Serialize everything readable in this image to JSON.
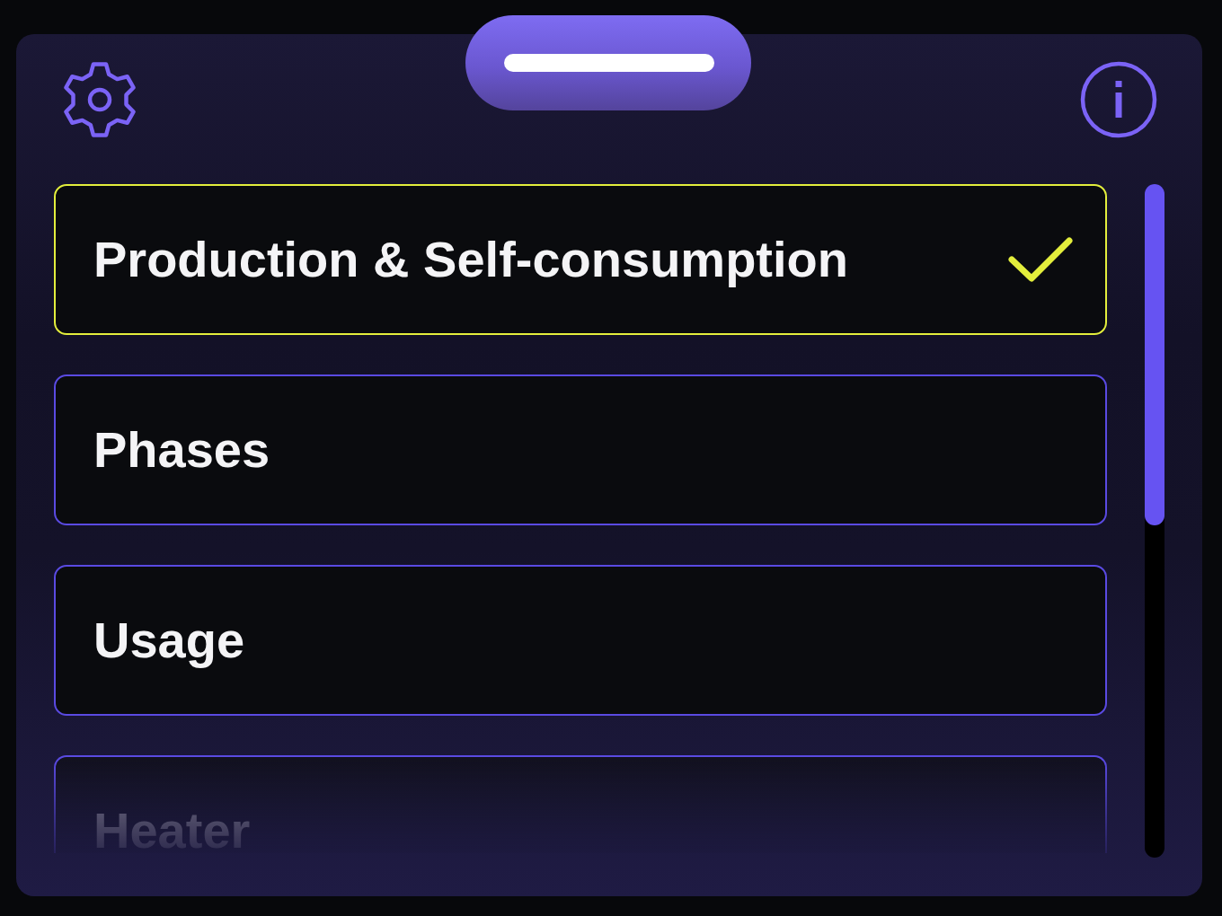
{
  "options": [
    {
      "label": "Production & Self-consumption",
      "selected": true
    },
    {
      "label": "Phases",
      "selected": false
    },
    {
      "label": "Usage",
      "selected": false
    },
    {
      "label": "Heater",
      "selected": false
    }
  ]
}
